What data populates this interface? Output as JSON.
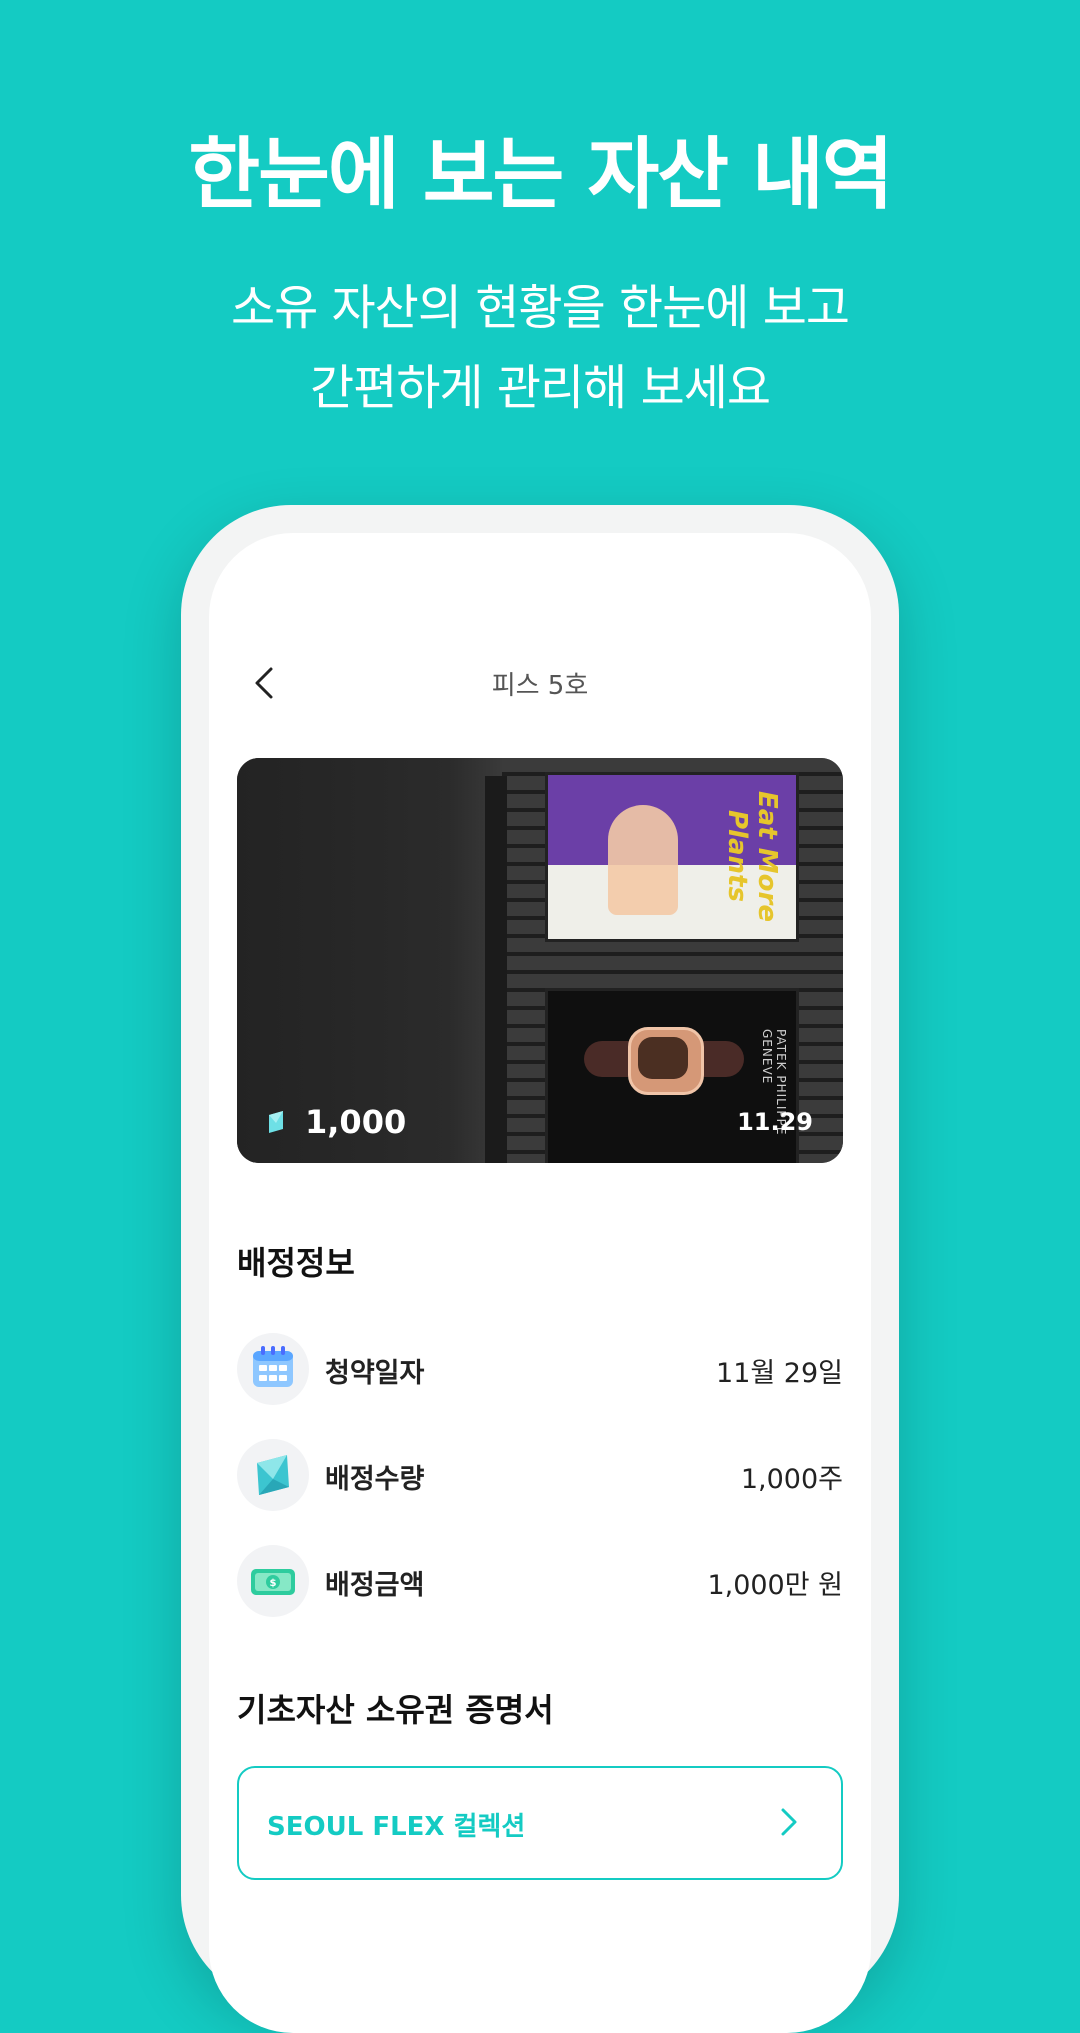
{
  "hero_text": {
    "headline": "한눈에 보는 자산 내역",
    "subline_1": "소유 자산의 현황을 한눈에 보고",
    "subline_2": "간편하게 관리해 보세요"
  },
  "screen": {
    "title": "피스 5호",
    "card": {
      "amount": "1,000",
      "date": "11.29",
      "artwork_text": "Eat More Plants",
      "watch_brand": "PATEK PHILIPPE GENEVE"
    },
    "allocation": {
      "title": "배정정보",
      "rows": [
        {
          "icon": "calendar-icon",
          "label": "청약일자",
          "value": "11월 29일"
        },
        {
          "icon": "gem-icon",
          "label": "배정수량",
          "value": "1,000주"
        },
        {
          "icon": "money-icon",
          "label": "배정금액",
          "value": "1,000만 원"
        }
      ]
    },
    "certificate": {
      "title": "기초자산 소유권 증명서",
      "collection_label": "SEOUL FLEX 컬렉션"
    }
  },
  "colors": {
    "background": "#14CBC3",
    "accent": "#14CBC3"
  }
}
